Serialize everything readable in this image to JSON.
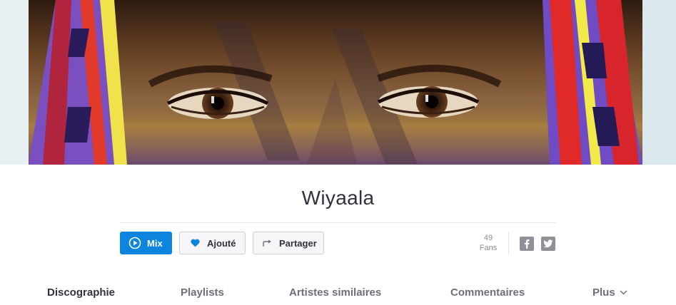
{
  "artist": {
    "name": "Wiyaala"
  },
  "actions": {
    "mix_label": "Mix",
    "favorite_label": "Ajouté",
    "share_label": "Partager"
  },
  "fans": {
    "count": "49",
    "label": "Fans"
  },
  "social": {
    "facebook_icon": "facebook-icon",
    "twitter_icon": "twitter-icon"
  },
  "tabs": [
    {
      "label": "Discographie",
      "active": true
    },
    {
      "label": "Playlists",
      "active": false
    },
    {
      "label": "Artistes similaires",
      "active": false
    },
    {
      "label": "Commentaires",
      "active": false
    },
    {
      "label": "Plus",
      "active": false
    }
  ],
  "colors": {
    "accent": "#0d84dd",
    "text": "#32323d",
    "muted": "#6f6f7a"
  }
}
